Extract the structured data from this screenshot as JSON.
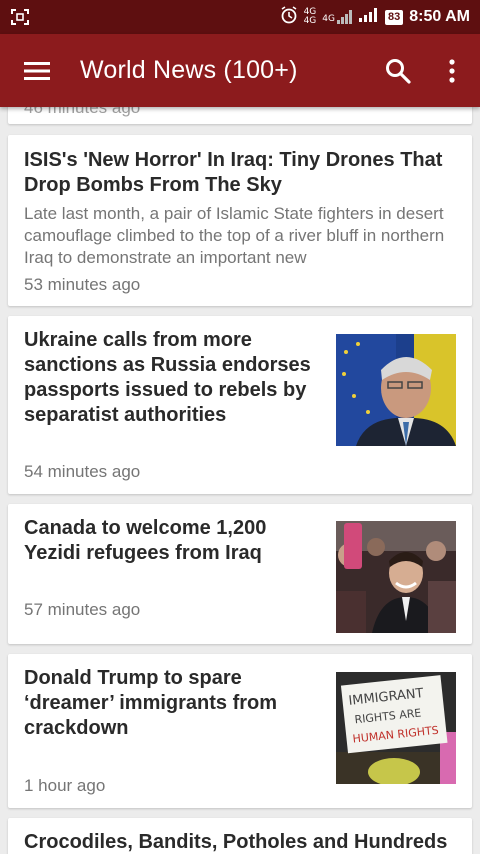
{
  "status": {
    "network_top": "4G",
    "network_bottom": "4G",
    "network2": "4G",
    "battery": "83",
    "time": "8:50 AM"
  },
  "app_bar": {
    "title": "World News (100+)"
  },
  "icons": {
    "menu": "hamburger-menu-icon",
    "search": "search-icon",
    "overflow": "more-vert-icon"
  },
  "colors": {
    "status_bar": "#5e0f10",
    "app_bar": "#8c1b1d",
    "background": "#ececec"
  },
  "feed": {
    "partial_time": "46 minutes ago",
    "articles": [
      {
        "title": "ISIS's 'New Horror' In Iraq: Tiny Drones That Drop Bombs From The Sky",
        "summary": "Late last month, a pair of Islamic State fighters in desert camouflage climbed to the top of a river bluff in northern Iraq to demonstrate an important new",
        "time": "53 minutes ago"
      },
      {
        "title": "Ukraine calls from more sanctions as Russia endorses passports issued to rebels by separatist authorities",
        "time": "54 minutes ago"
      },
      {
        "title": "Canada to welcome 1,200 Yezidi refugees from Iraq",
        "time": "57 minutes ago"
      },
      {
        "title": "Donald Trump to spare ‘dreamer’ immigrants from crackdown",
        "time": "1 hour ago",
        "sign_text": [
          "IMMIGRANT",
          "RIGHTS ARE",
          "HUMAN RIGHTS"
        ]
      },
      {
        "title": "Crocodiles, Bandits, Potholes and Hundreds"
      }
    ]
  }
}
